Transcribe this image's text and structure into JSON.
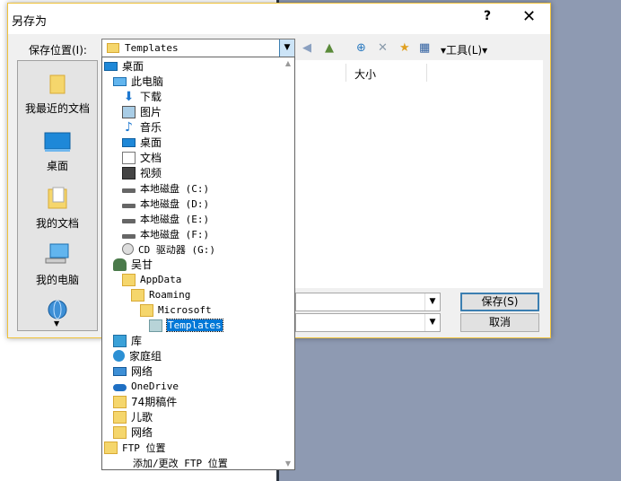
{
  "dialog": {
    "title": "另存为",
    "help": "?",
    "close": "✕",
    "save_in_label": "保存位置(I):",
    "save_in_value": "Templates",
    "tools_label": "工具(L)",
    "save_button": "保存(S)",
    "cancel_button": "取消"
  },
  "toolbar": {
    "back": "◀",
    "up": "▲",
    "search": "⊕",
    "delete": "✕",
    "new_folder": "★",
    "views": "▦"
  },
  "places": [
    {
      "label": "我最近的文档",
      "icon": "recent-folder-icon"
    },
    {
      "label": "桌面",
      "icon": "desktop-icon"
    },
    {
      "label": "我的文档",
      "icon": "documents-folder-icon"
    },
    {
      "label": "我的电脑",
      "icon": "computer-icon"
    },
    {
      "label": "",
      "icon": "network-globe-icon"
    }
  ],
  "file_list": {
    "columns": [
      "大小"
    ]
  },
  "dropdown_items": [
    {
      "label": "桌面",
      "icon": "desktop-icon",
      "mono": false
    },
    {
      "label": "此电脑",
      "icon": "this-pc-icon",
      "mono": false
    },
    {
      "label": "下载",
      "icon": "downloads-icon",
      "mono": false
    },
    {
      "label": "图片",
      "icon": "pictures-icon",
      "mono": false
    },
    {
      "label": "音乐",
      "icon": "music-icon",
      "mono": false
    },
    {
      "label": "桌面",
      "icon": "desktop-icon",
      "mono": false
    },
    {
      "label": "文档",
      "icon": "documents-icon",
      "mono": false
    },
    {
      "label": "视频",
      "icon": "videos-icon",
      "mono": false
    },
    {
      "label": "本地磁盘 (C:)",
      "icon": "drive-icon",
      "mono": true
    },
    {
      "label": "本地磁盘 (D:)",
      "icon": "drive-icon",
      "mono": true
    },
    {
      "label": "本地磁盘 (E:)",
      "icon": "drive-icon",
      "mono": true
    },
    {
      "label": "本地磁盘 (F:)",
      "icon": "drive-icon",
      "mono": true
    },
    {
      "label": "CD 驱动器 (G:)",
      "icon": "cd-drive-icon",
      "mono": true
    },
    {
      "label": "吴甘",
      "icon": "user-icon",
      "mono": false
    },
    {
      "label": "AppData",
      "icon": "folder-icon",
      "mono": true
    },
    {
      "label": "Roaming",
      "icon": "folder-icon",
      "mono": true
    },
    {
      "label": "Microsoft",
      "icon": "folder-icon",
      "mono": true
    },
    {
      "label": "Templates",
      "icon": "templates-folder-icon",
      "mono": true
    },
    {
      "label": "库",
      "icon": "library-icon",
      "mono": false
    },
    {
      "label": "家庭组",
      "icon": "homegroup-icon",
      "mono": false
    },
    {
      "label": "网络",
      "icon": "network-icon",
      "mono": false
    },
    {
      "label": "OneDrive",
      "icon": "onedrive-icon",
      "mono": true
    },
    {
      "label": "74期稿件",
      "icon": "folder-icon",
      "mono": false
    },
    {
      "label": "儿歌",
      "icon": "folder-icon",
      "mono": false
    },
    {
      "label": "网络",
      "icon": "folder-icon",
      "mono": false
    },
    {
      "label": "FTP 位置",
      "icon": "folder-icon",
      "mono": true
    },
    {
      "label": "添加/更改 FTP 位置",
      "icon": "",
      "mono": true
    }
  ]
}
